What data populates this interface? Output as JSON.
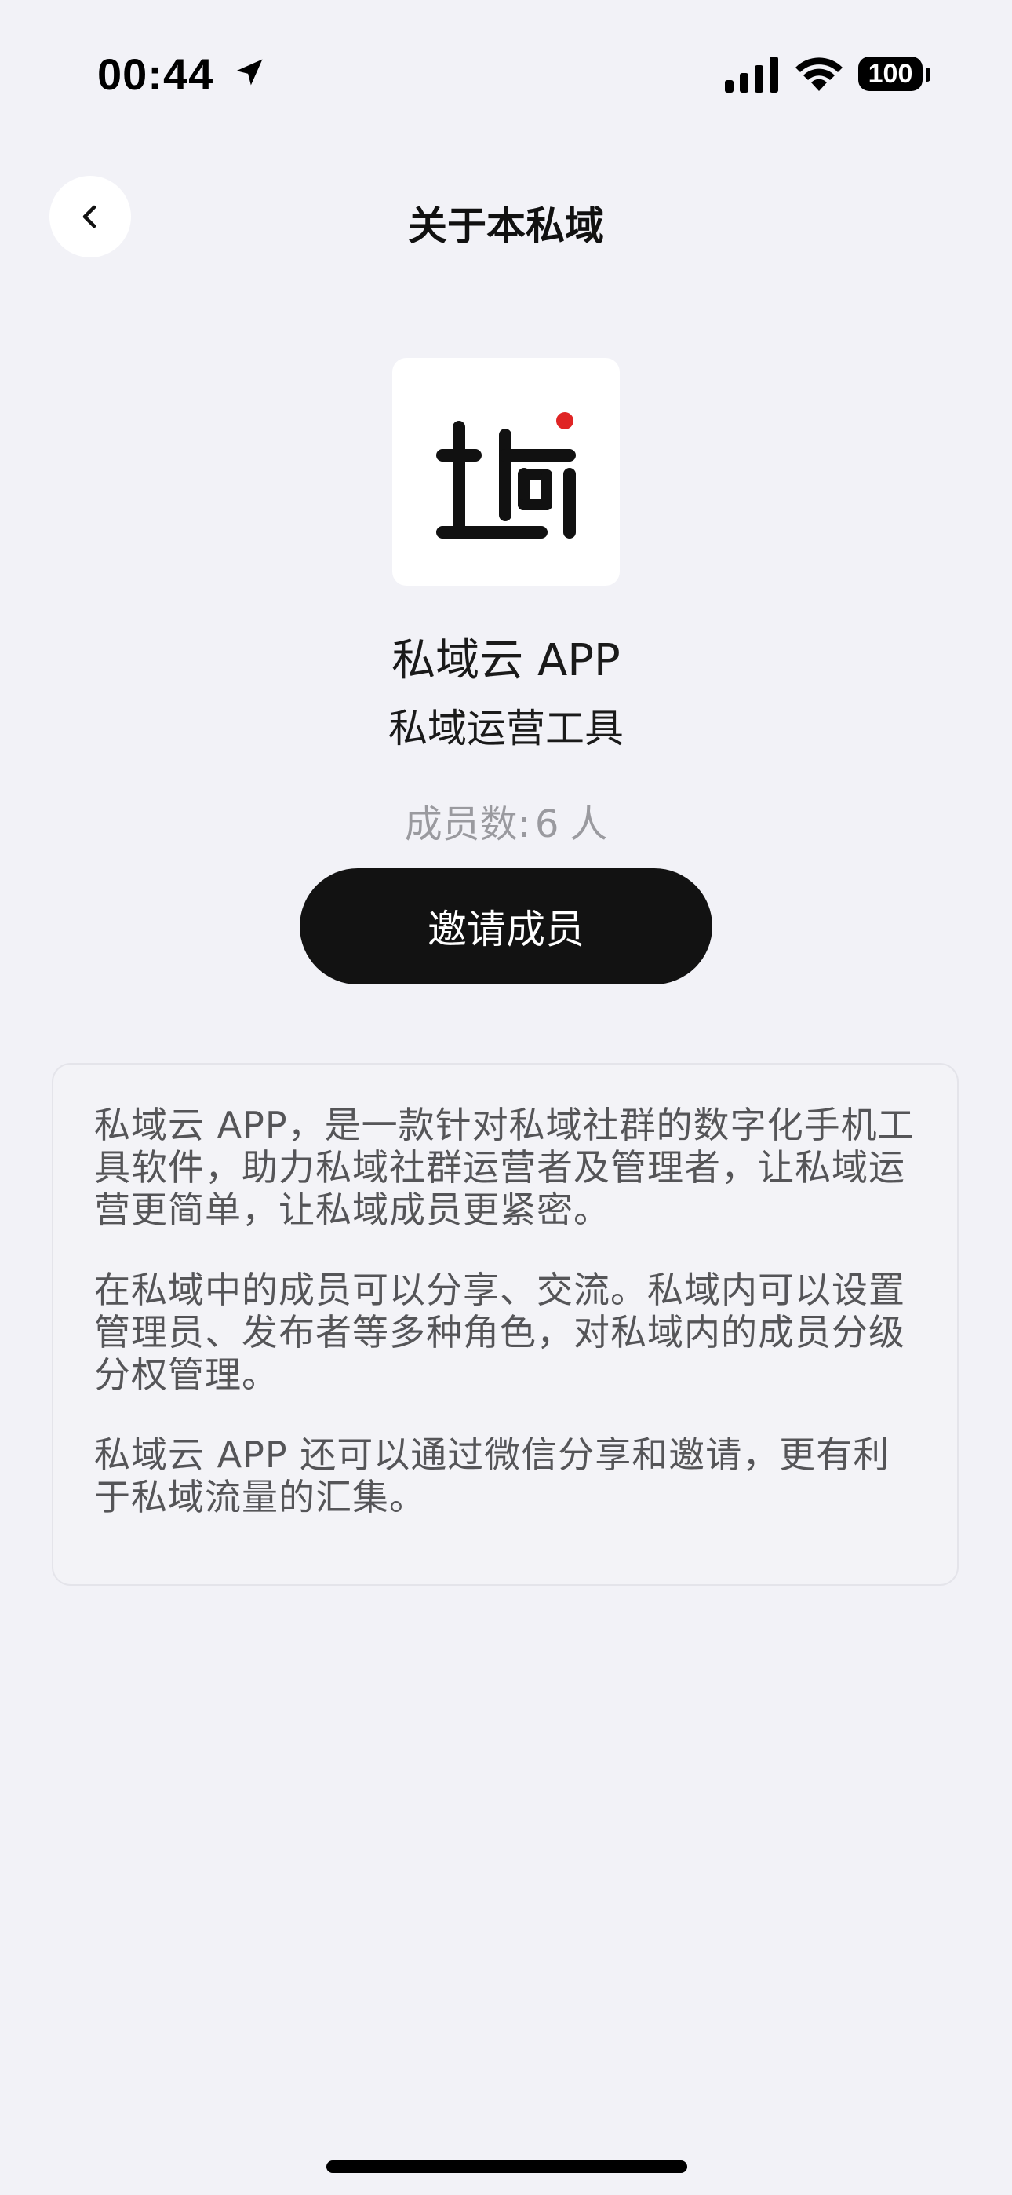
{
  "status_bar": {
    "time": "00:44",
    "battery": "100"
  },
  "nav": {
    "title": "关于本私域"
  },
  "app": {
    "logo_text": "域",
    "name": "私域云 APP",
    "subtitle": "私域运营工具",
    "member_label": "成员数:",
    "member_count": "6",
    "member_unit": "人",
    "invite_label": "邀请成员"
  },
  "description": {
    "paragraphs": [
      "私域云 APP，是一款针对私域社群的数字化手机工具软件，助力私域社群运营者及管理者，让私域运营更简单，让私域成员更紧密。",
      "在私域中的成员可以分享、交流。私域内可以设置管理员、发布者等多种角色，对私域内的成员分级分权管理。",
      "私域云 APP 还可以通过微信分享和邀请，更有利于私域流量的汇集。"
    ]
  },
  "colors": {
    "background": "#f2f2f7",
    "button": "#121212",
    "logo_dot": "#e02424",
    "muted_text": "#9a9a9f"
  },
  "icons": [
    "location-arrow-icon",
    "signal-icon",
    "wifi-icon",
    "battery-icon",
    "chevron-left-icon"
  ]
}
